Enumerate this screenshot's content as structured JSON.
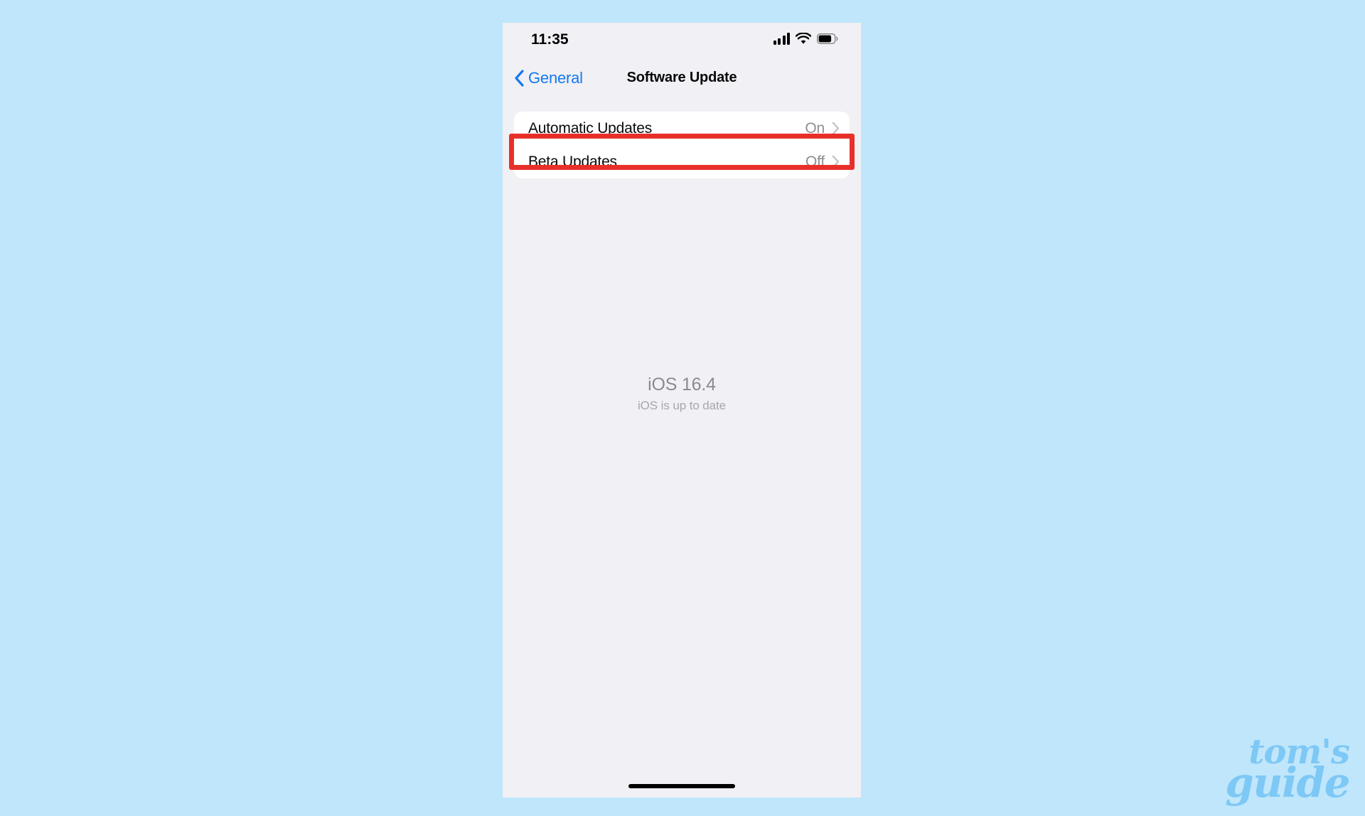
{
  "colors": {
    "canvas_background": "#bfe6fb",
    "screen_background": "#f1f0f4",
    "card_background": "#ffffff",
    "accent_blue": "#1479ef",
    "highlight_red": "#e8302a",
    "value_gray": "#8e8e93",
    "watermark_blue": "#7ec8f5"
  },
  "status_bar": {
    "time": "11:35",
    "cellular_icon": "cellular-signal-icon",
    "wifi_icon": "wifi-icon",
    "battery_icon": "battery-icon"
  },
  "nav_bar": {
    "back_icon": "chevron-left-icon",
    "back_label": "General",
    "title": "Software Update"
  },
  "settings_group": {
    "rows": [
      {
        "label": "Automatic Updates",
        "value": "On",
        "chevron_icon": "chevron-right-icon",
        "highlighted": true
      },
      {
        "label": "Beta Updates",
        "value": "Off",
        "chevron_icon": "chevron-right-icon",
        "highlighted": false
      }
    ]
  },
  "version_info": {
    "title": "iOS 16.4",
    "subtitle": "iOS is up to date"
  },
  "home_indicator": {
    "name": "home-indicator-bar"
  },
  "watermark": {
    "line_one": "tom's",
    "line_two": "guide"
  }
}
